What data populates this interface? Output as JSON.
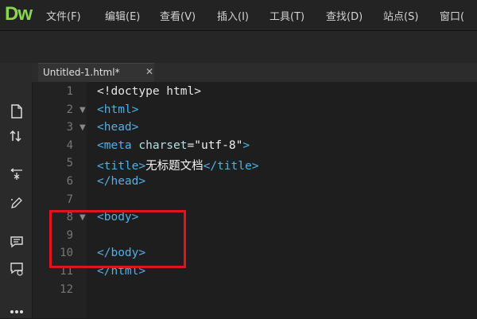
{
  "app": {
    "logo": "Dw"
  },
  "menu": [
    "文件(F)",
    "编辑(E)",
    "查看(V)",
    "插入(I)",
    "工具(T)",
    "查找(D)",
    "站点(S)",
    "窗口("
  ],
  "tab": {
    "label": "Untitled-1.html*",
    "close": "✕"
  },
  "code_lines": [
    {
      "n": "1",
      "fold": false,
      "segments": [
        {
          "t": "txt0",
          "v": "<!doctype html>"
        }
      ]
    },
    {
      "n": "2",
      "fold": true,
      "segments": [
        {
          "t": "tag",
          "v": "<html>"
        }
      ]
    },
    {
      "n": "3",
      "fold": true,
      "segments": [
        {
          "t": "tag",
          "v": "<head>"
        }
      ]
    },
    {
      "n": "4",
      "fold": false,
      "segments": [
        {
          "t": "tag",
          "v": "<meta "
        },
        {
          "t": "attr",
          "v": "charset"
        },
        {
          "t": "plain",
          "v": "="
        },
        {
          "t": "str",
          "v": "\"utf-8\""
        },
        {
          "t": "tag",
          "v": ">"
        }
      ]
    },
    {
      "n": "5",
      "fold": false,
      "segments": [
        {
          "t": "tag",
          "v": "<title>"
        },
        {
          "t": "txt",
          "v": "无标题文档"
        },
        {
          "t": "tag",
          "v": "</title>"
        }
      ]
    },
    {
      "n": "6",
      "fold": false,
      "segments": [
        {
          "t": "tag",
          "v": "</head>"
        }
      ]
    },
    {
      "n": "7",
      "fold": false,
      "segments": []
    },
    {
      "n": "8",
      "fold": true,
      "segments": [
        {
          "t": "tag",
          "v": "<body>"
        }
      ]
    },
    {
      "n": "9",
      "fold": false,
      "segments": []
    },
    {
      "n": "10",
      "fold": false,
      "segments": [
        {
          "t": "tag",
          "v": "</body>"
        }
      ]
    },
    {
      "n": "11",
      "fold": false,
      "segments": [
        {
          "t": "tag",
          "v": "</html>"
        }
      ]
    },
    {
      "n": "12",
      "fold": false,
      "segments": []
    }
  ],
  "tools": [
    "file-icon",
    "sort-icon",
    "wand-icon",
    "pen-icon",
    "comment-icon",
    "comment-edit-icon",
    "more-icon"
  ],
  "colors": {
    "logo": "#8ad44f",
    "tag": "#4fb0e8",
    "highlight": "#e0151b"
  }
}
